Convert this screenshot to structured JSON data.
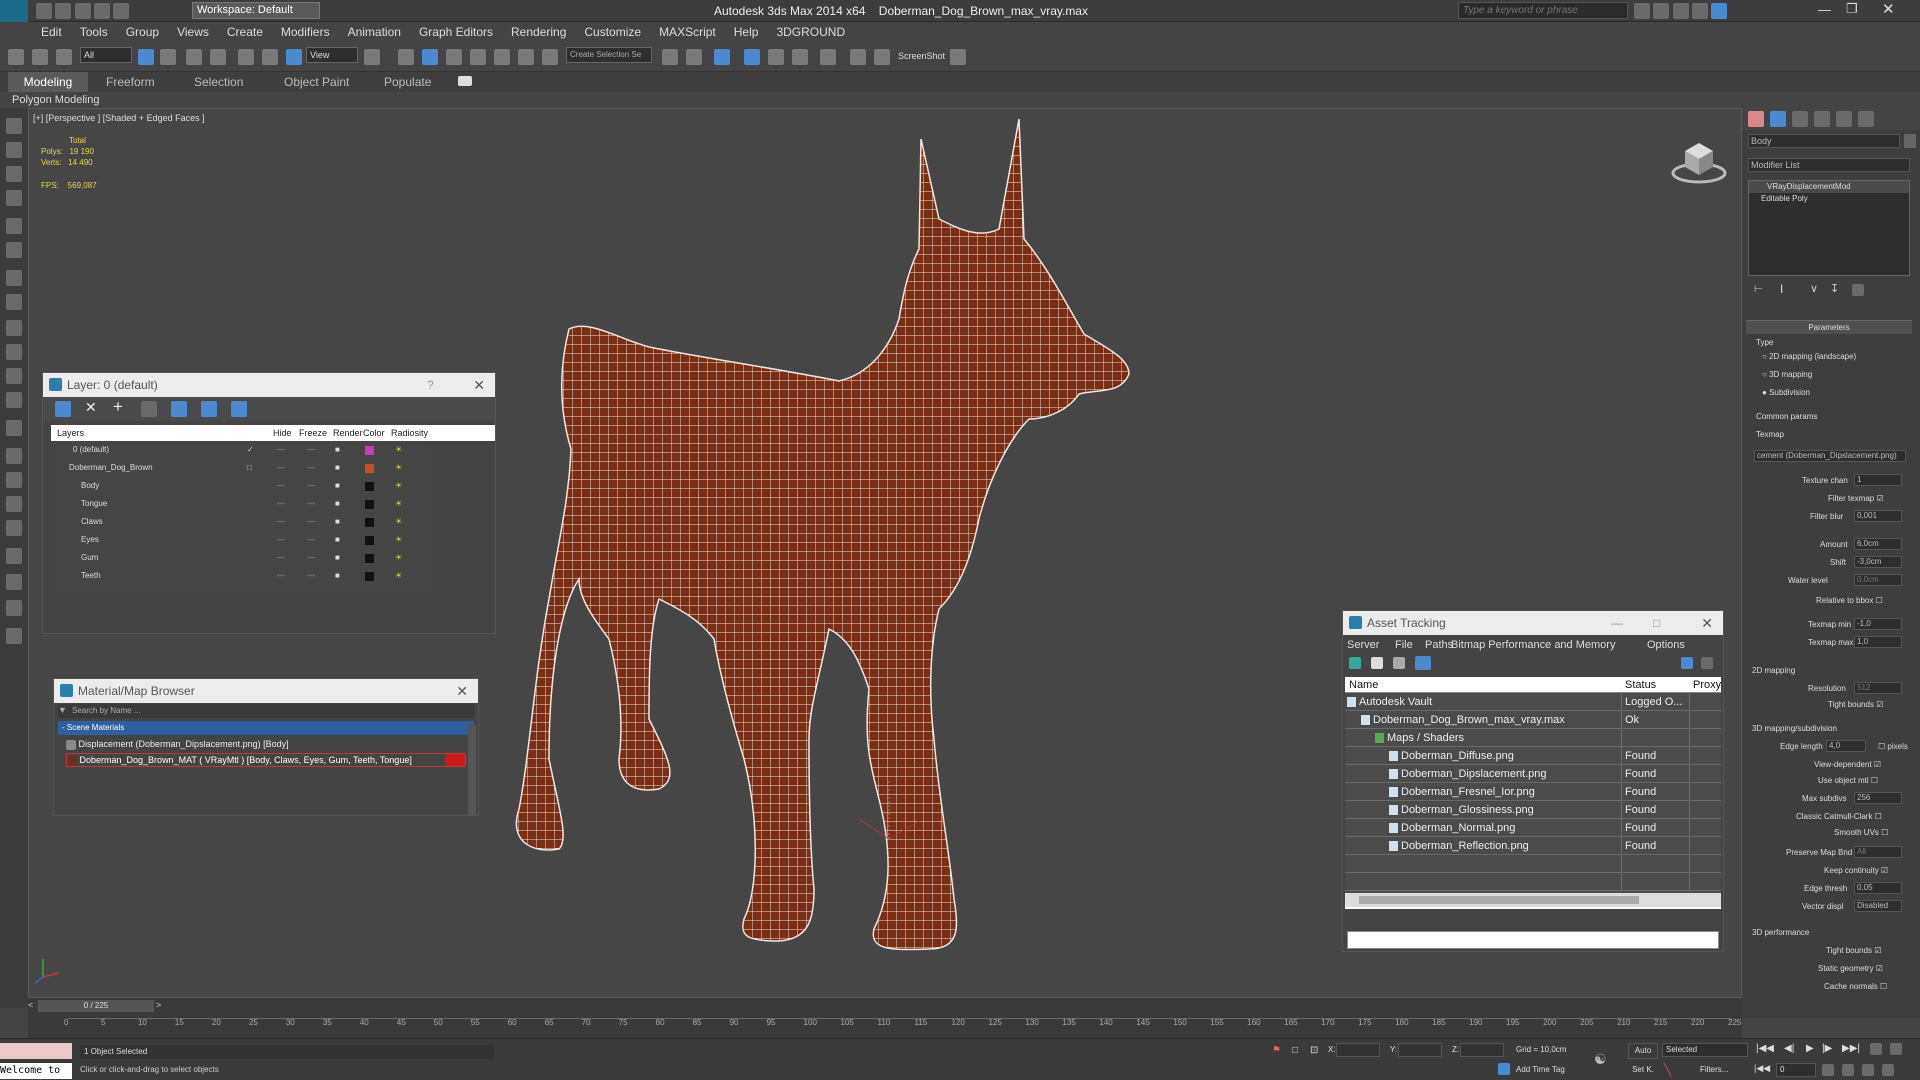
{
  "app": {
    "title": "Autodesk 3ds Max  2014 x64",
    "file": "Doberman_Dog_Brown_max_vray.max",
    "workspace": "Workspace: Default",
    "search_placeholder": "Type a keyword or phrase"
  },
  "menu": [
    "Edit",
    "Tools",
    "Group",
    "Views",
    "Create",
    "Modifiers",
    "Animation",
    "Graph Editors",
    "Rendering",
    "Customize",
    "MAXScript",
    "Help",
    "3DGROUND"
  ],
  "toolbar": {
    "selection_filter": "All",
    "ref_coord": "View",
    "named_selection": "Create Selection Se",
    "screenshot": "ScreenShot"
  },
  "ribbon": {
    "tabs": [
      "Modeling",
      "Freeform",
      "Selection",
      "Object Paint",
      "Populate"
    ],
    "sub": "Polygon Modeling"
  },
  "viewport": {
    "label": "[+] [Perspective ] [Shaded + Edged Faces ]",
    "stats": {
      "total": "Total",
      "polys_label": "Polys:",
      "polys": "19 190",
      "verts_label": "Verts:",
      "verts": "14 490",
      "fps_label": "FPS:",
      "fps": "569,087"
    }
  },
  "layer_panel": {
    "title": "Layer: 0 (default)",
    "help": "?",
    "columns": [
      "Layers",
      "Hide",
      "Freeze",
      "Render",
      "Color",
      "Radiosity"
    ],
    "rows": [
      {
        "name": "0 (default)",
        "color": "#c83cb4"
      },
      {
        "name": "Doberman_Dog_Brown",
        "color": "#c8501e"
      },
      {
        "name": "Body",
        "color": "#111111"
      },
      {
        "name": "Tongue",
        "color": "#111111"
      },
      {
        "name": "Claws",
        "color": "#111111"
      },
      {
        "name": "Eyes",
        "color": "#111111"
      },
      {
        "name": "Gum",
        "color": "#111111"
      },
      {
        "name": "Teeth",
        "color": "#111111"
      }
    ]
  },
  "material_browser": {
    "title": "Material/Map Browser",
    "search": "Search by Name ...",
    "section": "- Scene Materials",
    "items": [
      "Displacement (Doberman_Dipslacement.png) [Body]",
      "Doberman_Dog_Brown_MAT  ( VRayMtl ) [Body, Claws, Eyes, Gum, Teeth, Tongue]"
    ]
  },
  "asset_tracking": {
    "title": "Asset Tracking",
    "menu": [
      "Server",
      "File",
      "Paths",
      "Bitmap Performance and Memory",
      "Options"
    ],
    "columns": [
      "Name",
      "Status",
      "Proxy"
    ],
    "rows": [
      {
        "name": "Autodesk Vault",
        "status": "Logged O...",
        "indent": 0
      },
      {
        "name": "Doberman_Dog_Brown_max_vray.max",
        "status": "Ok",
        "indent": 1
      },
      {
        "name": "Maps / Shaders",
        "status": "",
        "indent": 2
      },
      {
        "name": "Doberman_Diffuse.png",
        "status": "Found",
        "indent": 3
      },
      {
        "name": "Doberman_Dipslacement.png",
        "status": "Found",
        "indent": 3
      },
      {
        "name": "Doberman_Fresnel_Ior.png",
        "status": "Found",
        "indent": 3
      },
      {
        "name": "Doberman_Glossiness.png",
        "status": "Found",
        "indent": 3
      },
      {
        "name": "Doberman_Normal.png",
        "status": "Found",
        "indent": 3
      },
      {
        "name": "Doberman_Reflection.png",
        "status": "Found",
        "indent": 3
      }
    ]
  },
  "command_panel": {
    "object_name": "Body",
    "modifier_list": "Modifier List",
    "stack": [
      "VRayDisplacementMod",
      "Editable Poly"
    ],
    "rollout_parameters": "Parameters",
    "type_label": "Type",
    "type_options": [
      "2D mapping (landscape)",
      "3D mapping",
      "Subdivision"
    ],
    "common_params": "Common params",
    "texmap_label": "Texmap",
    "texmap": "cement (Doberman_Dipslacement.png)",
    "texture_chan_label": "Texture chan",
    "texture_chan": "1",
    "filter_texmap": "Filter texmap",
    "filter_blur_label": "Filter blur",
    "filter_blur": "0,001",
    "amount_label": "Amount",
    "amount": "6,0cm",
    "shift_label": "Shift",
    "shift": "-3,0cm",
    "water_level_label": "Water level",
    "water_level": "0,0cm",
    "relative_bbox": "Relative to bbox",
    "texmap_min_label": "Texmap min",
    "texmap_min": "-1,0",
    "texmap_max_label": "Texmap max",
    "texmap_max": "1,0",
    "mapping_2d": "2D mapping",
    "resolution_label": "Resolution",
    "resolution": "512",
    "tight_bounds": "Tight bounds",
    "mapping_3d": "3D mapping/subdivision",
    "edge_length_label": "Edge length",
    "edge_length": "4,0",
    "pixels": "pixels",
    "view_dependent": "View-dependent",
    "use_object_mtl": "Use object mtl",
    "max_subdivs_label": "Max subdivs",
    "max_subdivs": "256",
    "classic_catmull": "Classic Catmull-Clark",
    "smooth_uvs": "Smooth UVs",
    "preserve_map_bnd": "Preserve Map Bnd",
    "preserve_map_val": "All",
    "keep_continuity": "Keep continuity",
    "edge_thresh_label": "Edge thresh",
    "edge_thresh": "0,05",
    "vector_displ_label": "Vector displ",
    "vector_displ": "Disabled",
    "perf_3d": "3D performance",
    "tight_bounds2": "Tight bounds",
    "static_geometry": "Static geometry",
    "cache_normals": "Cache normals"
  },
  "timeline": {
    "frame": "0 / 225",
    "ticks": [
      "0",
      "5",
      "10",
      "15",
      "20",
      "25",
      "30",
      "35",
      "40",
      "45",
      "50",
      "55",
      "60",
      "65",
      "70",
      "75",
      "80",
      "85",
      "90",
      "95",
      "100",
      "105",
      "110",
      "115",
      "120",
      "125",
      "130",
      "135",
      "140",
      "145",
      "150",
      "155",
      "160",
      "165",
      "170",
      "175",
      "180",
      "185",
      "190",
      "195",
      "200",
      "205",
      "210",
      "215",
      "220",
      "225"
    ]
  },
  "status": {
    "listener": "Welcome to",
    "objects": "1 Object Selected",
    "prompt": "Click or click-and-drag to select objects",
    "x_label": "X:",
    "y_label": "Y:",
    "z_label": "Z:",
    "grid": "Grid = 10,0cm",
    "auto": "Auto",
    "selected": "Selected",
    "set_k": "Set K.",
    "filters": "Filters...",
    "add_time_tag": "Add Time Tag",
    "frame_field": "0"
  }
}
